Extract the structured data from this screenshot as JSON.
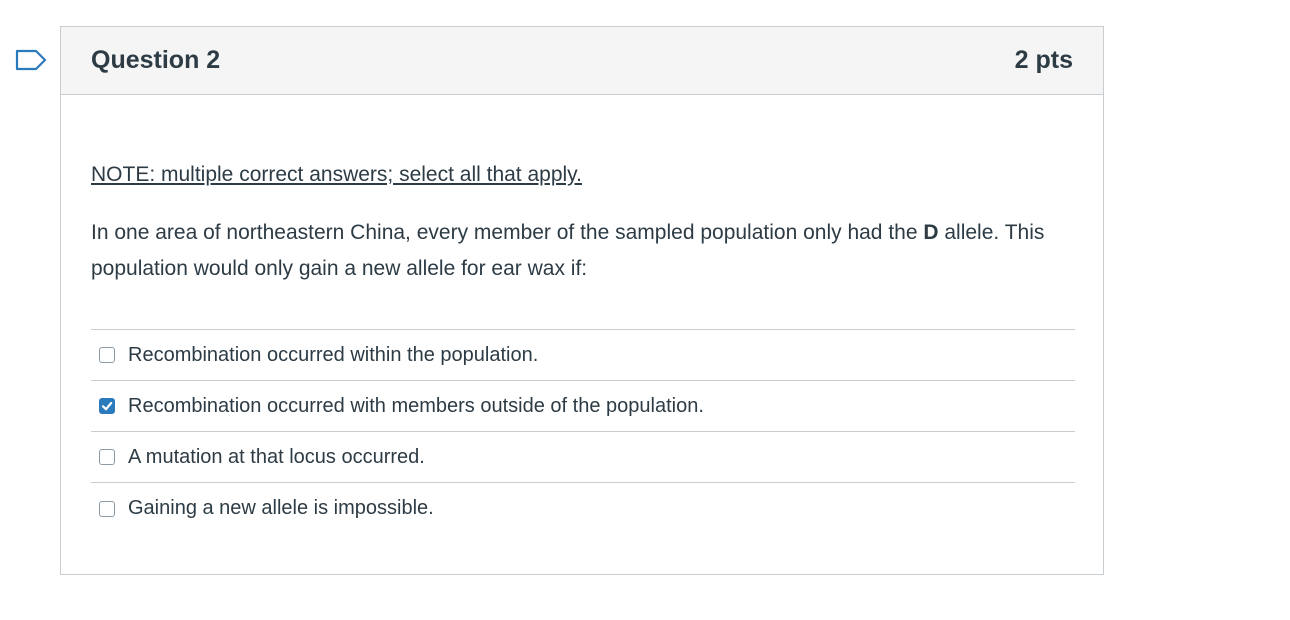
{
  "question": {
    "title": "Question 2",
    "points": "2 pts",
    "note": "NOTE: multiple correct answers; select all that apply.",
    "prompt_before": "In one area of northeastern China, every member of the sampled population only had the ",
    "prompt_bold": "D",
    "prompt_after": " allele. This population would only gain a new allele for ear wax if:",
    "answers": [
      {
        "label": "Recombination occurred within the population.",
        "checked": false
      },
      {
        "label": "Recombination occurred with members outside of the population.",
        "checked": true
      },
      {
        "label": "A mutation at that locus occurred.",
        "checked": false
      },
      {
        "label": "Gaining a new allele is impossible.",
        "checked": false
      }
    ]
  },
  "colors": {
    "accent": "#2b7abc",
    "border": "#c7cdd1",
    "header_bg": "#f5f5f5",
    "text": "#2d3b45"
  },
  "icons": {
    "flag": "flag-outline-icon",
    "check": "checkmark-icon"
  }
}
